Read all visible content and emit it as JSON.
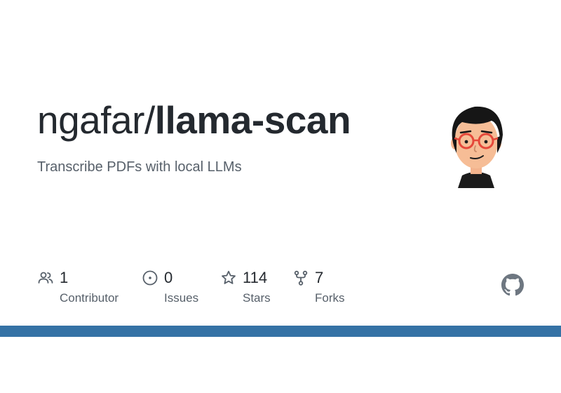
{
  "repo": {
    "owner": "ngafar/",
    "name": "llama-scan",
    "description": "Transcribe PDFs with local LLMs"
  },
  "stats": {
    "contributors": {
      "value": "1",
      "label": "Contributor",
      "icon": "people-icon"
    },
    "issues": {
      "value": "0",
      "label": "Issues",
      "icon": "issue-opened-icon"
    },
    "stars": {
      "value": "114",
      "label": "Stars",
      "icon": "star-icon"
    },
    "forks": {
      "value": "7",
      "label": "Forks",
      "icon": "repo-forked-icon"
    }
  },
  "avatar": {
    "icon": "owner-avatar-cartoon"
  },
  "branding": {
    "icon": "github-mark-icon"
  },
  "colors": {
    "text_primary": "#24292f",
    "text_secondary": "#57606a",
    "icon": "#57606a",
    "github_mark": "#6e7781",
    "language_bar": "#3572a5"
  }
}
